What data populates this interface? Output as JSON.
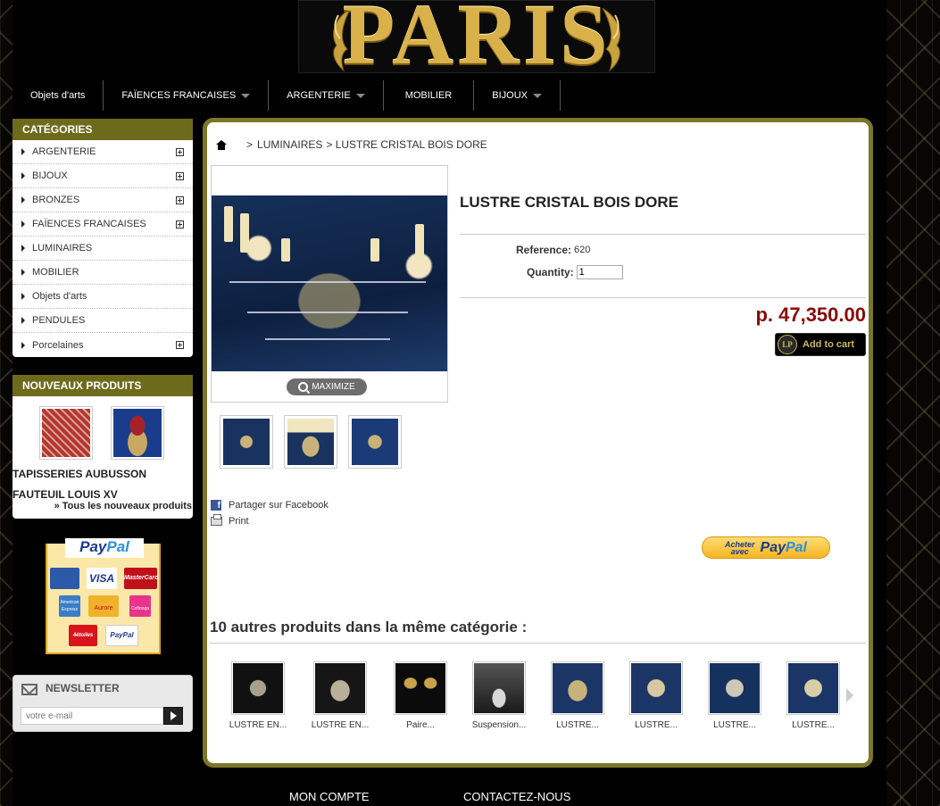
{
  "colors": {
    "accent_olive": "#6e6a1c",
    "price_red": "#8b0a0a",
    "background": "#000000",
    "gold": "#d8b14a"
  },
  "header": {
    "logo_text": "PARIS"
  },
  "topnav": [
    {
      "label": "Objets d'arts",
      "has_dropdown": false
    },
    {
      "label": "FAÏENCES FRANCAISES",
      "has_dropdown": true
    },
    {
      "label": "ARGENTERIE",
      "has_dropdown": true
    },
    {
      "label": "MOBILIER",
      "has_dropdown": false
    },
    {
      "label": "BIJOUX",
      "has_dropdown": true
    }
  ],
  "categories": {
    "title": "CATÉGORIES",
    "items": [
      {
        "label": "ARGENTERIE",
        "expandable": true
      },
      {
        "label": "BIJOUX",
        "expandable": true
      },
      {
        "label": "BRONZES",
        "expandable": true
      },
      {
        "label": "FAÏENCES FRANCAISES",
        "expandable": true
      },
      {
        "label": "LUMINAIRES",
        "expandable": false
      },
      {
        "label": "MOBILIER",
        "expandable": false
      },
      {
        "label": "Objets d'arts",
        "expandable": false
      },
      {
        "label": "PENDULES",
        "expandable": false
      },
      {
        "label": "Porcelaines",
        "expandable": true
      }
    ]
  },
  "new_products": {
    "title": "NOUVEAUX PRODUITS",
    "items": [
      {
        "name": "TAPISSERIES AUBUSSON",
        "icon": "tapestry-image"
      },
      {
        "name": "FAUTEUIL LOUIS XV",
        "icon": "armchair-image"
      }
    ],
    "all_link": "» Tous les nouveaux produits"
  },
  "paypal_logos": {
    "title_a": "Pay",
    "title_b": "Pal",
    "cards": [
      "CB",
      "VISA",
      "MasterCard",
      "American Express",
      "Aurore",
      "Cofinoga",
      "4étoiles",
      "PayPal"
    ]
  },
  "newsletter": {
    "title": "NEWSLETTER",
    "placeholder": "votre e-mail"
  },
  "breadcrumb": {
    "separator": ">",
    "category": "LUMINAIRES",
    "current": "> LUSTRE CRISTAL BOIS DORE"
  },
  "product": {
    "title": "LUSTRE CRISTAL BOIS DORE",
    "reference_label": "Reference:",
    "reference_value": "620",
    "quantity_label": "Quantity:",
    "quantity_value": "1",
    "price": "p. 47,350.00",
    "add_to_cart": "Add to cart",
    "cart_badge": "LP",
    "maximize": "MAXIMIZE",
    "share_facebook": "Partager sur Facebook",
    "print": "Print",
    "paypal_checkout_small_1": "Acheter",
    "paypal_checkout_small_2": "avec",
    "paypal_checkout_a": "Pay",
    "paypal_checkout_b": "Pal"
  },
  "other_products": {
    "title": "10 autres produits dans la même catégorie :",
    "items": [
      {
        "label": "LUSTRE EN..."
      },
      {
        "label": "LUSTRE EN..."
      },
      {
        "label": "Paire..."
      },
      {
        "label": "Suspension..."
      },
      {
        "label": "LUSTRE..."
      },
      {
        "label": "LUSTRE..."
      },
      {
        "label": "LUSTRE..."
      },
      {
        "label": "LUSTRE..."
      }
    ]
  },
  "footer": {
    "account": "MON COMPTE",
    "contact": "CONTACTEZ-NOUS"
  }
}
